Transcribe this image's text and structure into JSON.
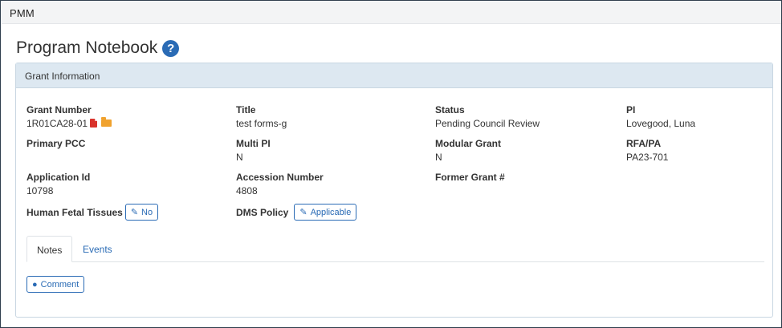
{
  "app": {
    "name": "PMM"
  },
  "page": {
    "title": "Program Notebook",
    "help_icon": "?"
  },
  "panel": {
    "heading": "Grant Information",
    "fields": {
      "grant_number": {
        "label": "Grant Number",
        "value": "1R01CA28-01"
      },
      "title": {
        "label": "Title",
        "value": "test forms-g"
      },
      "status": {
        "label": "Status",
        "value": "Pending Council Review"
      },
      "pi": {
        "label": "PI",
        "value": "Lovegood, Luna"
      },
      "primary_pcc": {
        "label": "Primary PCC",
        "value": ""
      },
      "multi_pi": {
        "label": "Multi PI",
        "value": "N"
      },
      "modular_grant": {
        "label": "Modular Grant",
        "value": "N"
      },
      "rfa_pa": {
        "label": "RFA/PA",
        "value": "PA23-701"
      },
      "application_id": {
        "label": "Application Id",
        "value": "10798"
      },
      "accession_number": {
        "label": "Accession Number",
        "value": "4808"
      },
      "former_grant": {
        "label": "Former Grant #",
        "value": ""
      },
      "human_fetal_tissues": {
        "label": "Human Fetal Tissues",
        "button": "No"
      },
      "dms_policy": {
        "label": "DMS Policy",
        "button": "Applicable"
      }
    },
    "tabs": [
      {
        "label": "Notes",
        "active": true
      },
      {
        "label": "Events",
        "active": false
      }
    ],
    "comment_button": "Comment"
  },
  "colors": {
    "accent": "#2a6bb5",
    "panel_heading_bg": "#dde8f1",
    "pdf": "#d9332c",
    "folder": "#f0a22e"
  },
  "icons": [
    "help-icon",
    "pdf-icon",
    "folder-icon",
    "pencil-icon",
    "comment-icon"
  ]
}
